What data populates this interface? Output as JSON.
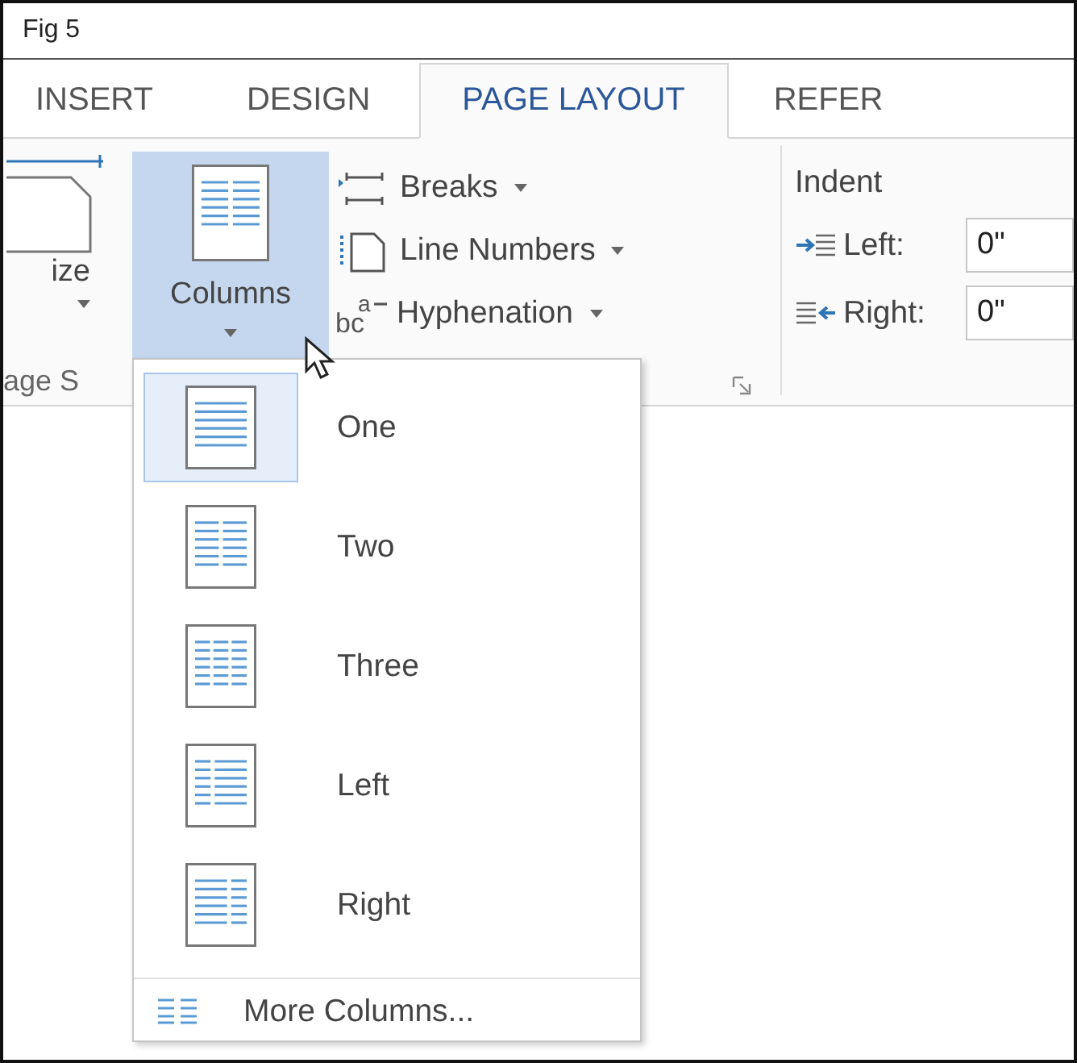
{
  "caption": "Fig 5",
  "tabs": [
    {
      "label": "INSERT",
      "selected": false
    },
    {
      "label": "DESIGN",
      "selected": false
    },
    {
      "label": "PAGE LAYOUT",
      "selected": true
    },
    {
      "label": "REFER",
      "selected": false
    }
  ],
  "ribbon": {
    "size_button": {
      "label": "ize"
    },
    "group_label": "age S",
    "columns_button": {
      "label": "Columns",
      "selected": true
    },
    "commands": [
      {
        "kind": "breaks",
        "label": "Breaks"
      },
      {
        "kind": "line-numbers",
        "label": "Line Numbers"
      },
      {
        "kind": "hyphenation",
        "label": "Hyphenation",
        "icon_text": "bc",
        "icon_superscript": "a"
      }
    ],
    "indent": {
      "title": "Indent",
      "fields": [
        {
          "kind": "left",
          "label": "Left:",
          "value": "0\""
        },
        {
          "kind": "right",
          "label": "Right:",
          "value": "0\""
        }
      ]
    }
  },
  "columns_menu": {
    "items": [
      {
        "kind": "one",
        "label": "One",
        "selected": true
      },
      {
        "kind": "two",
        "label": "Two",
        "selected": false
      },
      {
        "kind": "three",
        "label": "Three",
        "selected": false
      },
      {
        "kind": "left",
        "label": "Left",
        "selected": false
      },
      {
        "kind": "right",
        "label": "Right",
        "selected": false
      }
    ],
    "more": {
      "label": "More Columns..."
    }
  }
}
